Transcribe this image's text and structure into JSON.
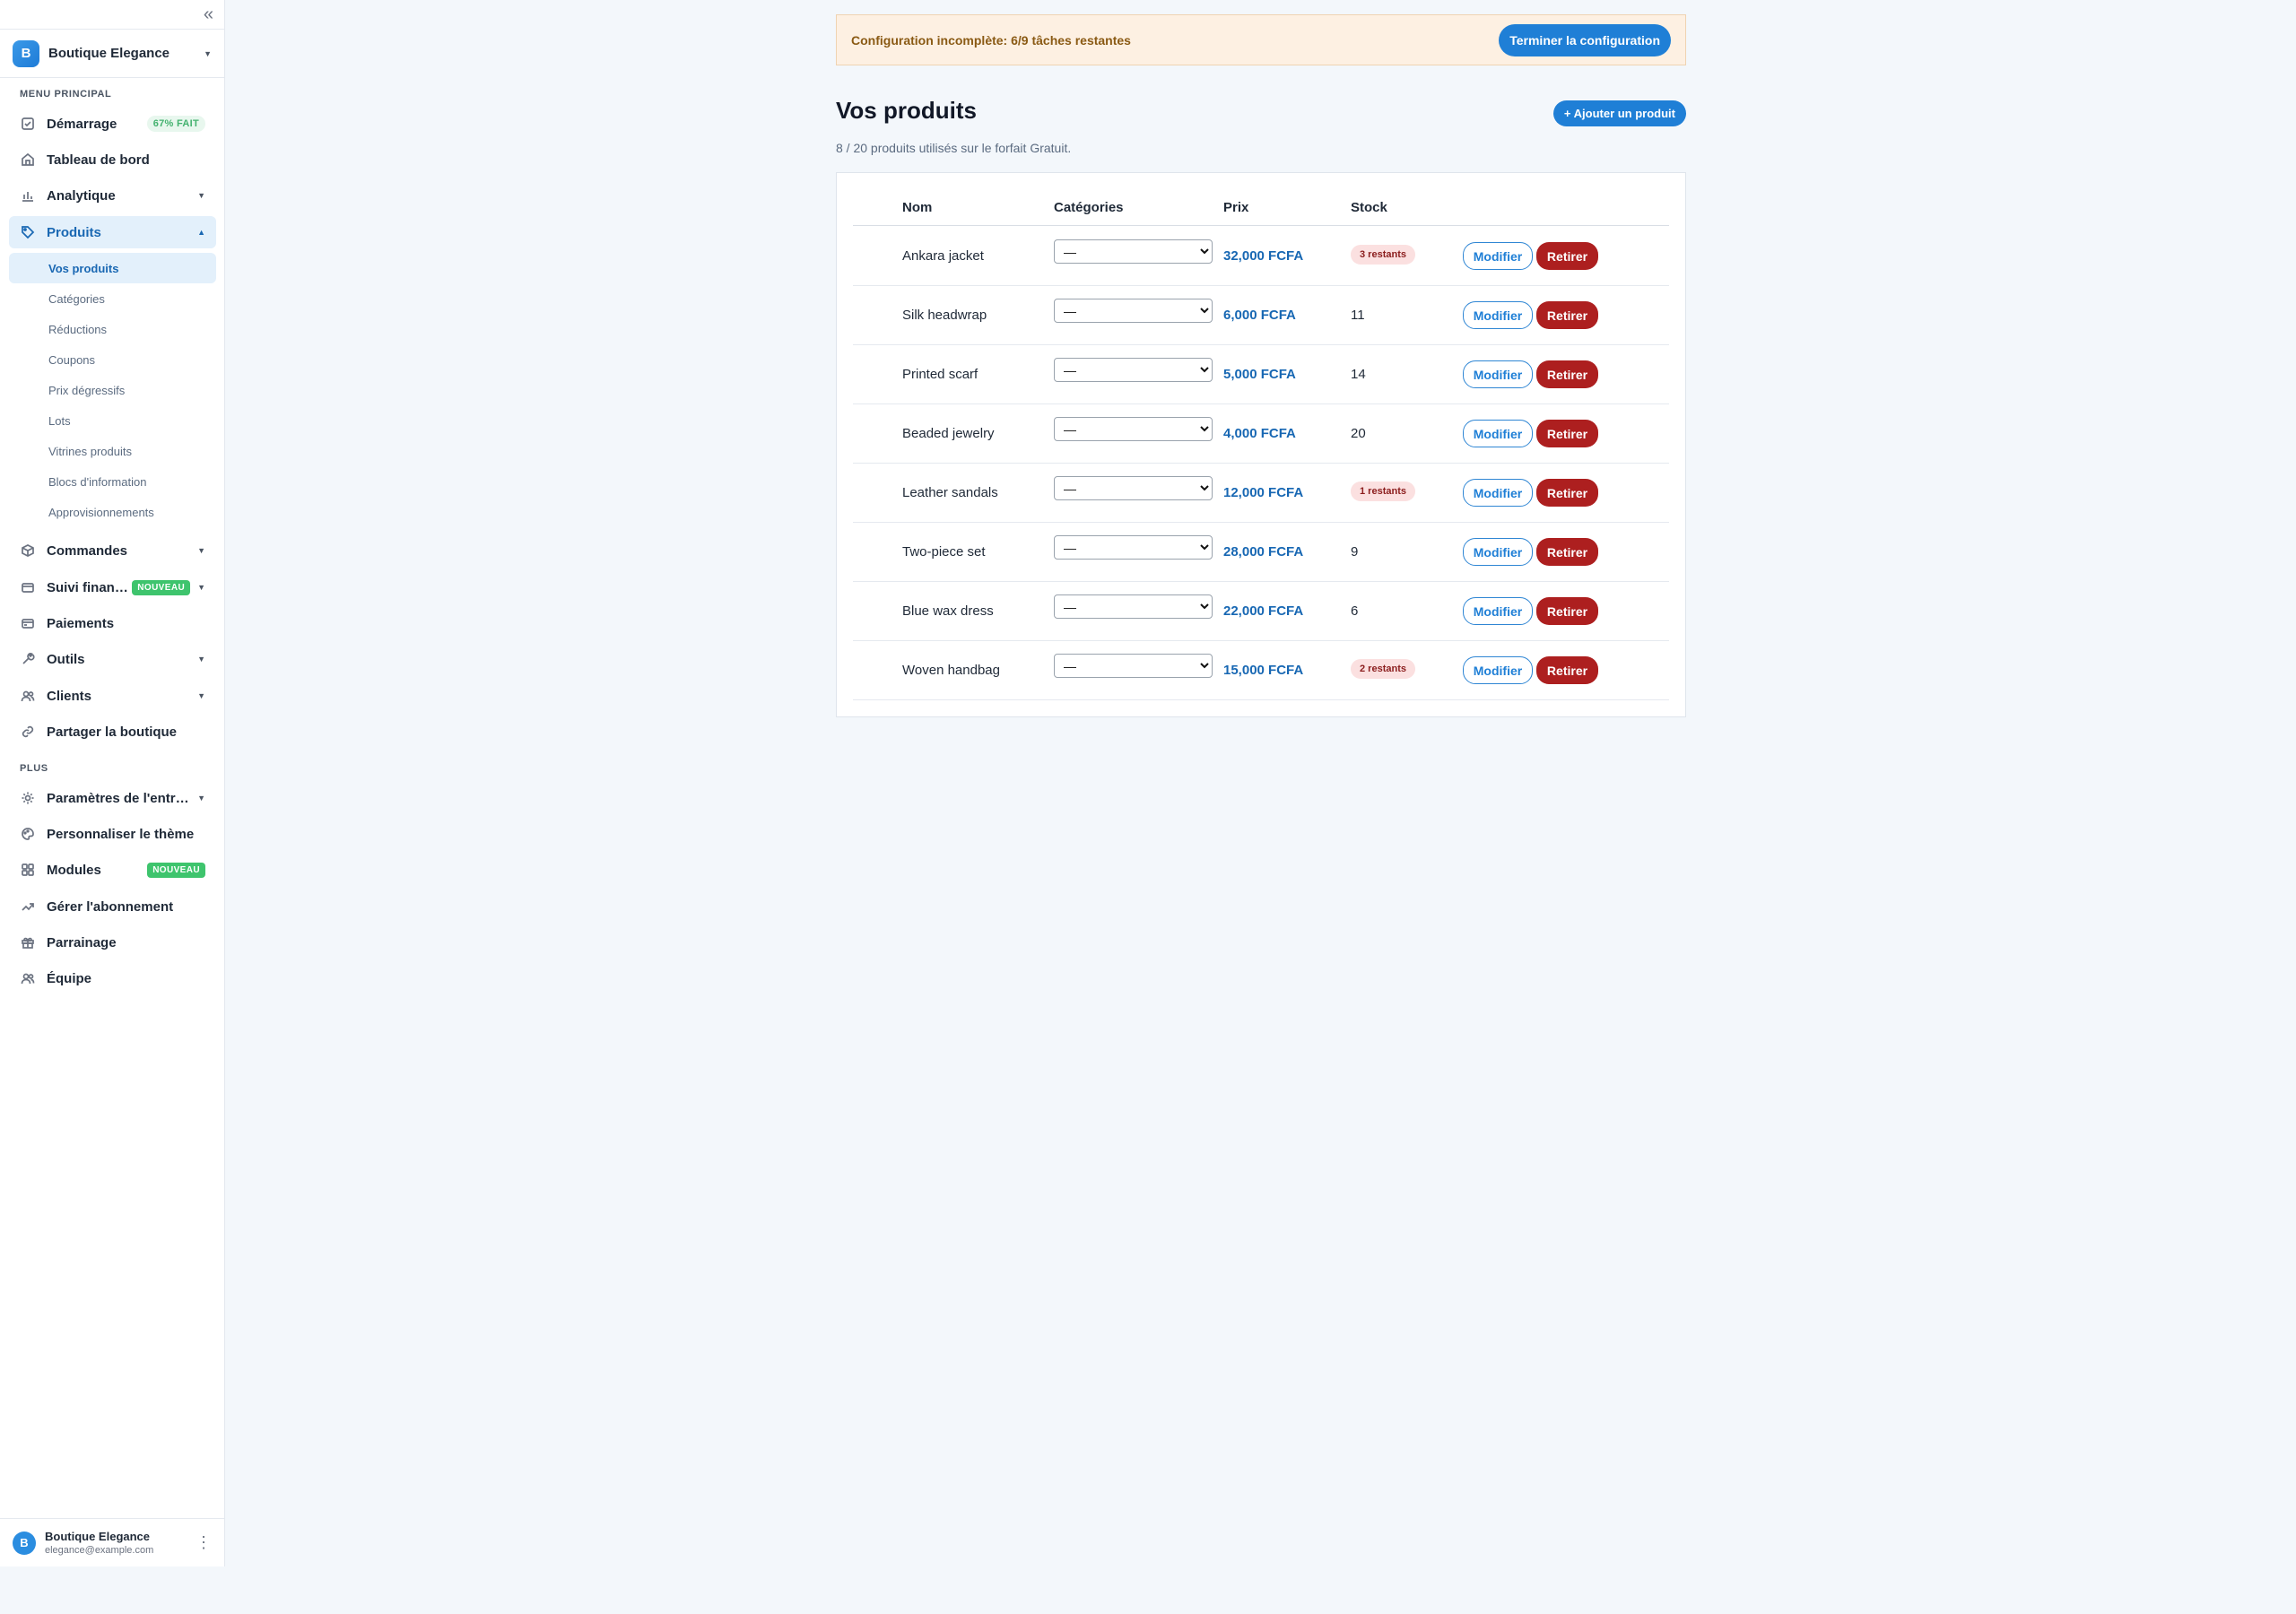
{
  "sidebar": {
    "collapse_glyph": "«",
    "store": {
      "initial": "B",
      "name": "Boutique Elegance"
    },
    "section_main": "MENU PRINCIPAL",
    "section_more": "PLUS",
    "items": [
      {
        "label": "Démarrage",
        "icon": "checkbox-icon",
        "badge": "67% FAIT"
      },
      {
        "label": "Tableau de bord",
        "icon": "home-icon"
      },
      {
        "label": "Analytique",
        "icon": "bar-chart-icon"
      },
      {
        "label": "Produits",
        "icon": "tag-icon"
      },
      {
        "label": "Commandes",
        "icon": "box-icon"
      },
      {
        "label": "Suivi financier",
        "icon": "card-icon",
        "badge": "NOUVEAU"
      },
      {
        "label": "Paiements",
        "icon": "wallet-icon"
      },
      {
        "label": "Outils",
        "icon": "wrench-icon"
      },
      {
        "label": "Clients",
        "icon": "users-icon"
      },
      {
        "label": "Partager la boutique",
        "icon": "link-icon"
      }
    ],
    "products_sub": [
      "Vos produits",
      "Catégories",
      "Réductions",
      "Coupons",
      "Prix dégressifs",
      "Lots",
      "Vitrines produits",
      "Blocs d'information",
      "Approvisionnements"
    ],
    "more_items": [
      {
        "label": "Paramètres de l'entreprise",
        "icon": "settings-icon"
      },
      {
        "label": "Personnaliser le thème",
        "icon": "palette-icon"
      },
      {
        "label": "Modules",
        "icon": "grid-icon",
        "badge": "NOUVEAU"
      },
      {
        "label": "Gérer l'abonnement",
        "icon": "trend-icon"
      },
      {
        "label": "Parrainage",
        "icon": "gift-icon"
      },
      {
        "label": "Équipe",
        "icon": "team-icon"
      }
    ],
    "user": {
      "initial": "B",
      "name": "Boutique Elegance",
      "email": "elegance@example.com"
    }
  },
  "banner": {
    "text": "Configuration incomplète: 6/9 tâches restantes",
    "button": "Terminer la configuration"
  },
  "main": {
    "title": "Vos produits",
    "add_button": "+ Ajouter un produit",
    "usage": "8 / 20 produits utilisés sur le forfait Gratuit.",
    "columns": {
      "name": "Nom",
      "categories": "Catégories",
      "price": "Prix",
      "stock": "Stock"
    },
    "select_placeholder": "—",
    "modify_label": "Modifier",
    "remove_label": "Retirer",
    "products": [
      {
        "name": "Ankara jacket",
        "price": "32,000 FCFA",
        "stock": "3 restants",
        "low": true
      },
      {
        "name": "Silk headwrap",
        "price": "6,000 FCFA",
        "stock": "11",
        "low": false
      },
      {
        "name": "Printed scarf",
        "price": "5,000 FCFA",
        "stock": "14",
        "low": false
      },
      {
        "name": "Beaded jewelry",
        "price": "4,000 FCFA",
        "stock": "20",
        "low": false
      },
      {
        "name": "Leather sandals",
        "price": "12,000 FCFA",
        "stock": "1 restants",
        "low": true
      },
      {
        "name": "Two-piece set",
        "price": "28,000 FCFA",
        "stock": "9",
        "low": false
      },
      {
        "name": "Blue wax dress",
        "price": "22,000 FCFA",
        "stock": "6",
        "low": false
      },
      {
        "name": "Woven handbag",
        "price": "15,000 FCFA",
        "stock": "2 restants",
        "low": true
      }
    ]
  },
  "colors": {
    "accent": "#1f7fd6",
    "danger": "#ad1f1f",
    "success": "#3ec46d",
    "banner_bg": "#fdf0e2"
  }
}
